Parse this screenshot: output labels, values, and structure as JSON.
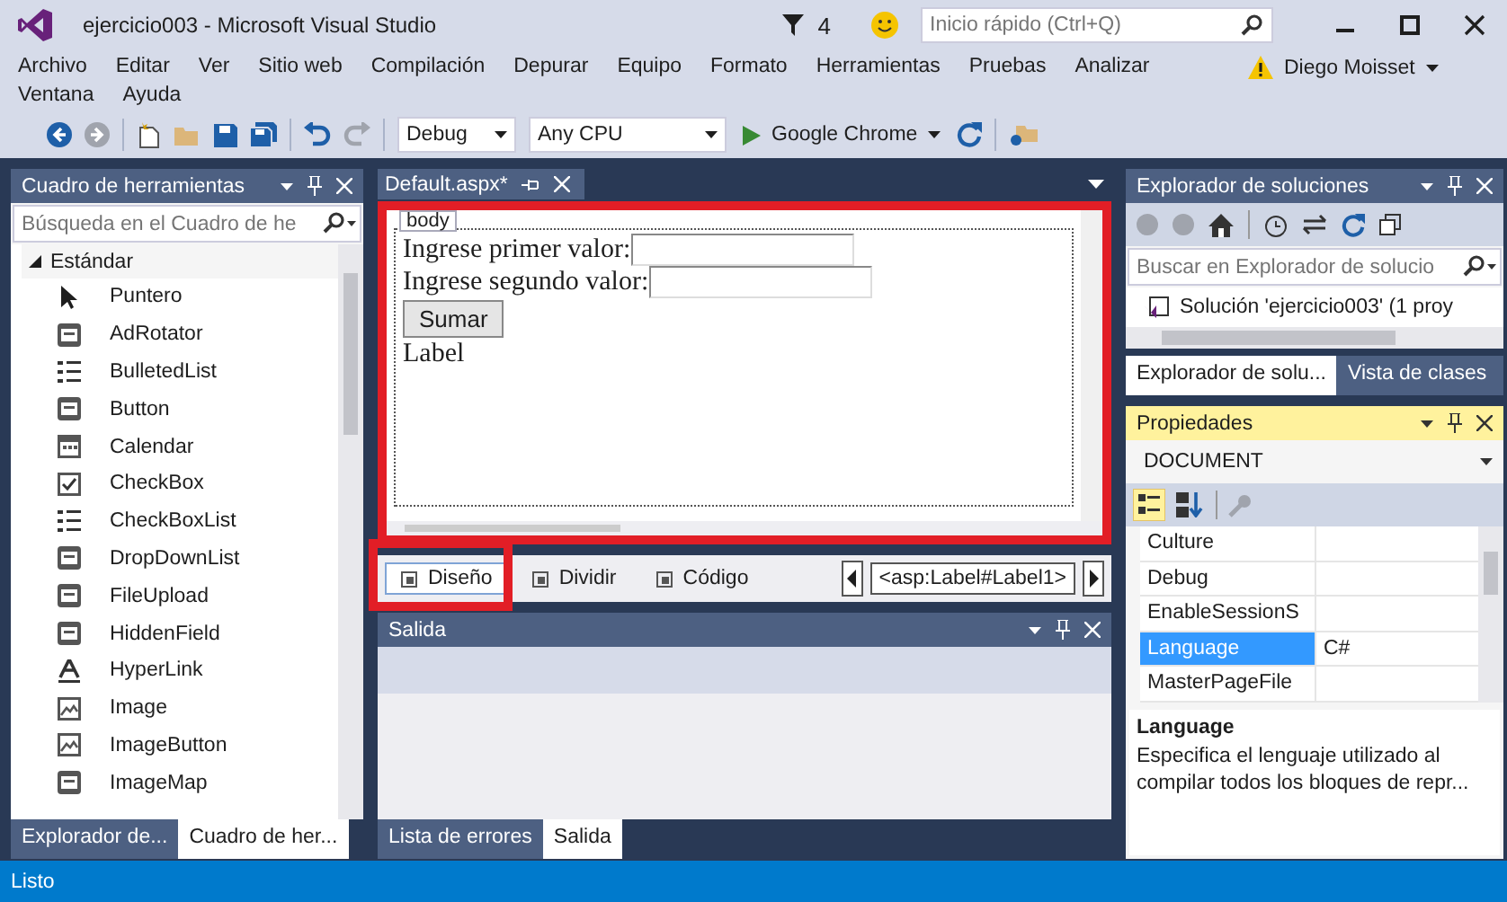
{
  "window": {
    "title": "ejercicio003 - Microsoft Visual Studio",
    "notification_count": "4",
    "quick_launch": {
      "placeholder": "Inicio rápido (Ctrl+Q)"
    },
    "user": "Diego Moisset"
  },
  "menu": [
    "Archivo",
    "Editar",
    "Ver",
    "Sitio web",
    "Compilación",
    "Depurar",
    "Equipo",
    "Formato",
    "Herramientas",
    "Pruebas",
    "Analizar",
    "Ventana",
    "Ayuda"
  ],
  "toolbar": {
    "configuration": "Debug",
    "platform": "Any CPU",
    "run_target": "Google Chrome"
  },
  "toolbox": {
    "title": "Cuadro de herramientas",
    "search": {
      "placeholder": "Búsqueda en el Cuadro de he"
    },
    "group": {
      "label": "Estándar",
      "expanded": true
    },
    "items": [
      {
        "label": "Puntero",
        "kind": "pointer"
      },
      {
        "label": "AdRotator",
        "kind": "control"
      },
      {
        "label": "BulletedList",
        "kind": "list"
      },
      {
        "label": "Button",
        "kind": "control"
      },
      {
        "label": "Calendar",
        "kind": "calendar"
      },
      {
        "label": "CheckBox",
        "kind": "checkbox"
      },
      {
        "label": "CheckBoxList",
        "kind": "list"
      },
      {
        "label": "DropDownList",
        "kind": "control"
      },
      {
        "label": "FileUpload",
        "kind": "control"
      },
      {
        "label": "HiddenField",
        "kind": "control"
      },
      {
        "label": "HyperLink",
        "kind": "link"
      },
      {
        "label": "Image",
        "kind": "image"
      },
      {
        "label": "ImageButton",
        "kind": "image"
      },
      {
        "label": "ImageMap",
        "kind": "control"
      }
    ]
  },
  "left_tabs": [
    {
      "label": "Explorador de...",
      "selected": false
    },
    {
      "label": "Cuadro de her...",
      "selected": true
    }
  ],
  "editor": {
    "tab": "Default.aspx*",
    "tag": "body",
    "fields": [
      {
        "label": "Ingrese primer valor:"
      },
      {
        "label": "Ingrese segundo valor:"
      }
    ],
    "button": "Sumar",
    "result_label": "Label",
    "view_tabs": [
      {
        "label": "Diseño",
        "selected": true
      },
      {
        "label": "Dividir",
        "selected": false
      },
      {
        "label": "Código",
        "selected": false
      }
    ],
    "breadcrumb": "<asp:Label#Label1>"
  },
  "output": {
    "title": "Salida"
  },
  "bottom_tabs": [
    {
      "label": "Lista de errores",
      "selected": false
    },
    {
      "label": "Salida",
      "selected": true
    }
  ],
  "solution_explorer": {
    "title": "Explorador de soluciones",
    "search": {
      "placeholder": "Buscar en Explorador de solucio"
    },
    "tree": [
      "Solución 'ejercicio003'  (1 proy"
    ]
  },
  "right_tabs": [
    {
      "label": "Explorador de solu...",
      "selected": true
    },
    {
      "label": "Vista de clases",
      "selected": false
    }
  ],
  "properties": {
    "title": "Propiedades",
    "object": "DOCUMENT",
    "rows": [
      {
        "name": "Culture",
        "selected": false
      },
      {
        "name": "Debug",
        "selected": false
      },
      {
        "name": "EnableSessionS",
        "selected": false
      },
      {
        "name": "Language",
        "value": "C#",
        "selected": true
      },
      {
        "name": "MasterPageFile",
        "selected": false
      }
    ],
    "description": {
      "title": "Language",
      "text": "Especifica el lenguaje utilizado al compilar todos los bloques de repr..."
    }
  },
  "status": "Listo"
}
